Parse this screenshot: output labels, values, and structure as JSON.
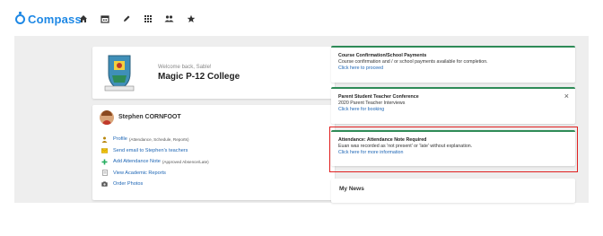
{
  "app": {
    "name": "Compass",
    "brand_color": "#1e88e5",
    "nav_icons": [
      "home-icon",
      "calendar-icon",
      "pencil-icon",
      "grid-icon",
      "people-icon",
      "star-icon"
    ]
  },
  "school_card": {
    "welcome": "Welcome back, Sable!",
    "school_name": "Magic P-12 College"
  },
  "profile": {
    "student_name": "Stephen CORNFOOT",
    "items": [
      {
        "label": "Profile",
        "detail": "(Attendance, Schedule, Reports)",
        "icon": "profile-icon"
      },
      {
        "label": "Send email to Stephen's teachers",
        "detail": "",
        "icon": "email-icon"
      },
      {
        "label": "Add Attendance Note",
        "detail": "(Approved Absence/Late)",
        "icon": "plus-icon"
      },
      {
        "label": "View Academic Reports",
        "detail": "",
        "icon": "report-icon"
      },
      {
        "label": "Order Photos",
        "detail": "",
        "icon": "camera-icon"
      }
    ]
  },
  "notices": [
    {
      "title": "Course Confirmation/School Payments",
      "body": "Course confirmation and / or school payments available for completion.",
      "link": "Click here to proceed"
    },
    {
      "title": "Parent Student Teacher Conference",
      "body": "2020 Parent Teacher Interviews",
      "link": "Click here for booking",
      "close": "×"
    },
    {
      "title": "Attendance: Attendance Note Required",
      "body": "Euan was recorded as 'not present' or 'late' without explanation.",
      "link": "Click here for more information"
    }
  ],
  "news": {
    "title": "My News"
  },
  "colors": {
    "accent_green": "#2e8b57",
    "highlight_red": "#e02020",
    "link_blue": "#1e66b5"
  }
}
